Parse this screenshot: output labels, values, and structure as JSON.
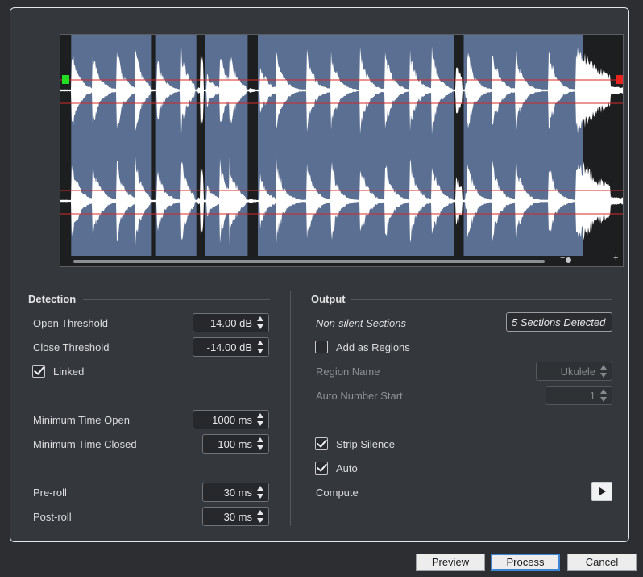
{
  "waveform": {
    "regions": [
      {
        "start": 0.019,
        "end": 0.162
      },
      {
        "start": 0.168,
        "end": 0.241
      },
      {
        "start": 0.257,
        "end": 0.332
      },
      {
        "start": 0.35,
        "end": 0.698
      },
      {
        "start": 0.715,
        "end": 0.926
      }
    ],
    "open_marker_color": "#22dd22",
    "close_marker_color": "#e8231e",
    "threshold_line_color": "#d42828",
    "region_color": "#5a6f92"
  },
  "detection": {
    "title": "Detection",
    "open_threshold": {
      "label": "Open Threshold",
      "value": "-14.00 dB"
    },
    "close_threshold": {
      "label": "Close Threshold",
      "value": "-14.00 dB"
    },
    "linked": {
      "label": "Linked",
      "checked": true
    },
    "min_time_open": {
      "label": "Minimum Time Open",
      "value": "1000 ms"
    },
    "min_time_closed": {
      "label": "Minimum Time Closed",
      "value": "100 ms"
    },
    "pre_roll": {
      "label": "Pre-roll",
      "value": "30 ms"
    },
    "post_roll": {
      "label": "Post-roll",
      "value": "30 ms"
    }
  },
  "output": {
    "title": "Output",
    "non_silent_label": "Non-silent Sections",
    "sections_detected": "5 Sections Detected",
    "add_as_regions": {
      "label": "Add as Regions",
      "checked": false
    },
    "region_name": {
      "label": "Region Name",
      "value": "Ukulele"
    },
    "auto_number_start": {
      "label": "Auto Number Start",
      "value": "1"
    },
    "strip_silence": {
      "label": "Strip Silence",
      "checked": true
    },
    "auto": {
      "label": "Auto",
      "checked": true
    },
    "compute_label": "Compute"
  },
  "buttons": {
    "preview": "Preview",
    "process": "Process",
    "cancel": "Cancel"
  }
}
